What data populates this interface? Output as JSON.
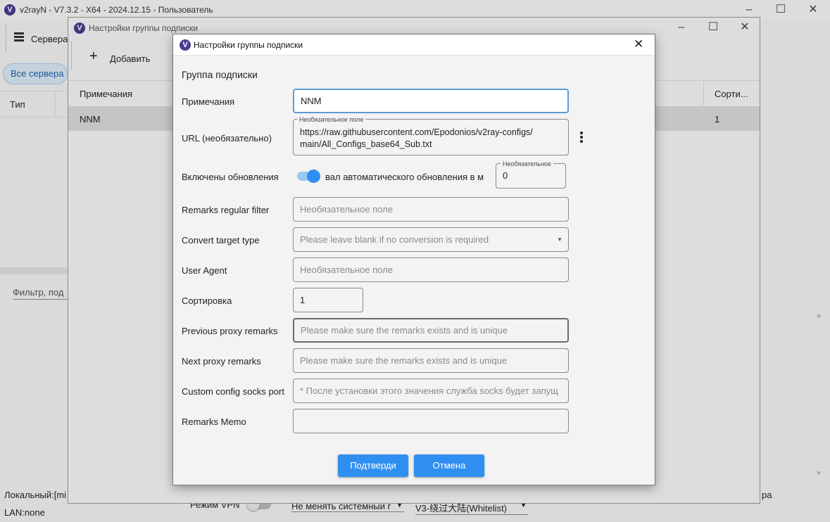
{
  "main_window": {
    "title": "v2rayN - V7.3.2 - X64 - 2024.12.15 - Пользователь",
    "menu_servers": "Сервера",
    "tab_all_servers": "Все сервера",
    "col_type": "Тип",
    "filter_placeholder": "Фильтр, под",
    "status_local": "Локальный:[mi",
    "status_lan": "LAN:none",
    "vpn_mode_label": "Режим VPN",
    "system_proxy_select": "Не менять системный г",
    "routing_select": "V3-绕过大陆(Whitelist)",
    "right_fragment": "ра"
  },
  "sub_window": {
    "title": "Настройки группы подписки",
    "add_button": "Добавить",
    "columns": [
      "Примечания",
      "Сорти..."
    ],
    "rows": [
      {
        "remarks": "NNM",
        "sort": "1"
      }
    ]
  },
  "dialog": {
    "title": "Настройки группы подписки",
    "section_title": "Группа подписки",
    "fields": {
      "remarks": {
        "label": "Примечания",
        "value": "NNM"
      },
      "url": {
        "label": "URL (необязательно)",
        "float_label": "Необязательное поле",
        "value_line1": "https://raw.githubusercontent.com/Epodonios/v2ray-configs/",
        "value_line2": "main/All_Configs_base64_Sub.txt"
      },
      "updates": {
        "label": "Включены обновления",
        "enabled": true,
        "interval_label": "вал автоматического обновления в м",
        "interval_float_label": "Необязательное",
        "interval_value": "0"
      },
      "remarks_filter": {
        "label": "Remarks regular filter",
        "placeholder": "Необязательное поле"
      },
      "convert_target": {
        "label": "Convert target type",
        "placeholder": "Please leave blank if no conversion is required"
      },
      "user_agent": {
        "label": "User Agent",
        "placeholder": "Необязательное поле"
      },
      "sort": {
        "label": "Сортировка",
        "value": "1"
      },
      "prev_proxy": {
        "label": "Previous proxy remarks",
        "placeholder": "Please make sure the remarks exists and is unique"
      },
      "next_proxy": {
        "label": "Next proxy remarks",
        "placeholder": "Please make sure the remarks exists and is unique"
      },
      "socks_port": {
        "label": "Custom config socks port",
        "placeholder": "* После установки этого значения служба socks будет запущ"
      },
      "memo": {
        "label": "Remarks Memo",
        "value": ""
      }
    },
    "confirm_button": "Подтверди",
    "cancel_button": "Отмена"
  },
  "colors": {
    "accent": "#2f8ff0",
    "focus_border": "#5b9bd5",
    "toggle": "#2f8ff0"
  },
  "icons": [
    "app-logo-icon",
    "servers-menu-icon",
    "plus-icon",
    "more-vert-icon",
    "dropdown-arrow-icon",
    "minimize-icon",
    "maximize-icon",
    "close-icon",
    "scroll-up-icon",
    "scroll-down-icon"
  ]
}
